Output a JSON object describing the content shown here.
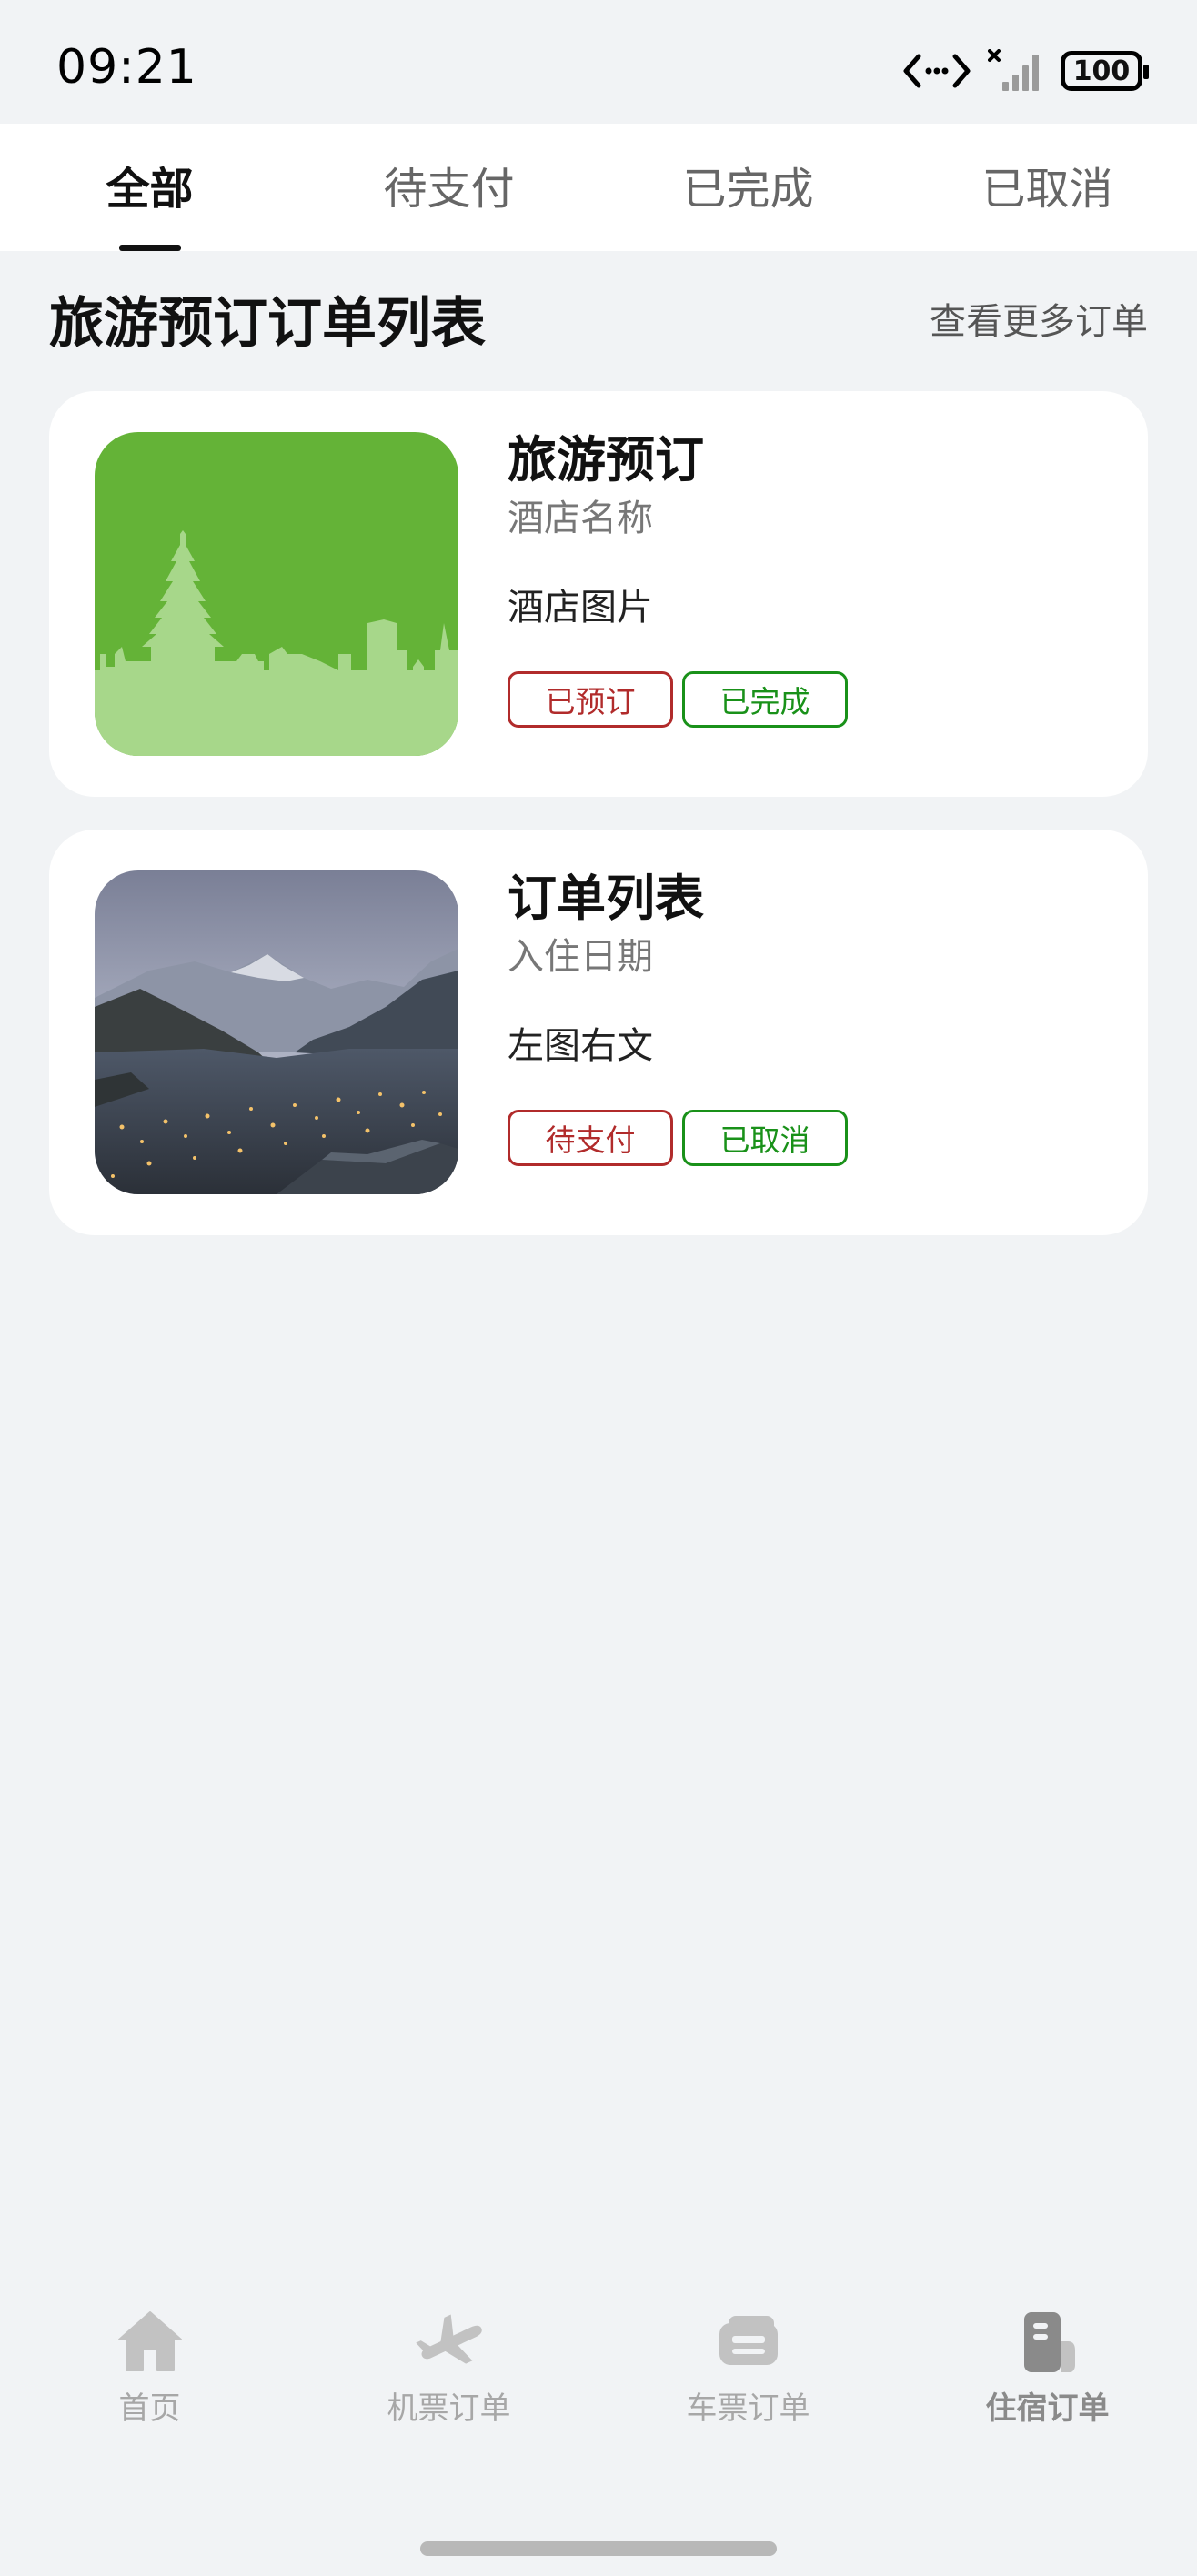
{
  "status_bar": {
    "time": "09:21",
    "battery": "100",
    "icons": [
      "data-transfer-icon",
      "no-sim-icon",
      "signal-icon",
      "battery-icon"
    ]
  },
  "tabs": [
    {
      "label": "全部",
      "active": true
    },
    {
      "label": "待支付",
      "active": false
    },
    {
      "label": "已完成",
      "active": false
    },
    {
      "label": "已取消",
      "active": false
    }
  ],
  "section": {
    "title": "旅游预订订单列表",
    "more_label": "查看更多订单"
  },
  "orders": [
    {
      "title": "旅游预订",
      "subtitle": "酒店名称",
      "description": "酒店图片",
      "tags": [
        {
          "label": "已预订",
          "color": "#b12b2b"
        },
        {
          "label": "已完成",
          "color": "#199119"
        }
      ],
      "image": "green-pagoda-skyline-illustration"
    },
    {
      "title": "订单列表",
      "subtitle": "入住日期",
      "description": "左图右文",
      "tags": [
        {
          "label": "待支付",
          "color": "#b12b2b"
        },
        {
          "label": "已取消",
          "color": "#199119"
        }
      ],
      "image": "mountain-town-dusk-photo"
    }
  ],
  "bottom_nav": [
    {
      "label": "首页",
      "icon": "home-icon",
      "active": false
    },
    {
      "label": "机票订单",
      "icon": "airplane-icon",
      "active": false
    },
    {
      "label": "车票订单",
      "icon": "ticket-icon",
      "active": false
    },
    {
      "label": "住宿订单",
      "icon": "hotel-icon",
      "active": true
    }
  ],
  "colors": {
    "background": "#f1f3f5",
    "tag_red": "#b12b2b",
    "tag_green": "#199119",
    "card_image_green": "#64b337"
  }
}
